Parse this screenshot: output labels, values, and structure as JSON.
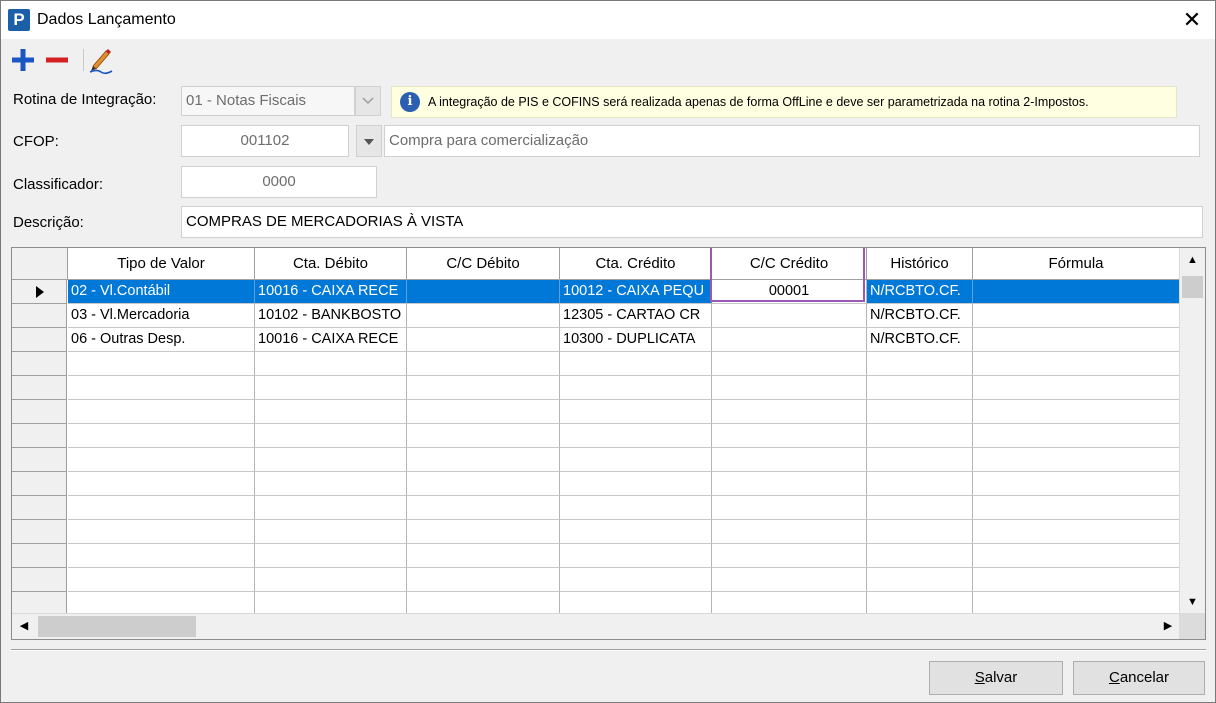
{
  "window": {
    "title": "Dados Lançamento",
    "app_icon_letter": "P",
    "close_glyph": "✕"
  },
  "toolbar": {
    "add_icon": "plus-icon",
    "remove_icon": "minus-icon",
    "edit_icon": "pencil-icon"
  },
  "form": {
    "rotina_label": "Rotina de Integração:",
    "rotina_value": "01 - Notas Fiscais",
    "info_text": "A integração de PIS e COFINS será realizada apenas de forma OffLine e deve ser parametrizada na rotina 2-Impostos.",
    "cfop_label": "CFOP:",
    "cfop_code": "001102",
    "cfop_desc": "Compra para comercialização",
    "classificador_label": "Classificador:",
    "classificador_value": "0000",
    "descricao_label": "Descrição:",
    "descricao_value": "COMPRAS DE MERCADORIAS À VISTA"
  },
  "grid": {
    "columns": [
      "Tipo de Valor",
      "Cta. Débito",
      "C/C Débito",
      "Cta. Crédito",
      "C/C Crédito",
      "Histórico",
      "Fórmula"
    ],
    "rows": [
      [
        "02 - Vl.Contábil",
        "10016 - CAIXA RECE",
        "",
        "10012 - CAIXA PEQU",
        "00001",
        "N/RCBTO.CF.",
        ""
      ],
      [
        "03 - Vl.Mercadoria",
        "10102 - BANKBOSTO",
        "",
        "12305 - CARTAO CR",
        "",
        "N/RCBTO.CF.",
        ""
      ],
      [
        "06 - Outras Desp.",
        "10016 - CAIXA RECE",
        "",
        "10300 - DUPLICATA",
        "",
        "N/RCBTO.CF.",
        ""
      ]
    ],
    "selected_row": 0
  },
  "buttons": {
    "salvar_accel": "S",
    "salvar_rest": "alvar",
    "cancelar_accel": "C",
    "cancelar_rest": "ancelar"
  },
  "colors": {
    "selection": "#0078d7",
    "focus_border": "#9b59b6",
    "info_bg": "#ffffe1",
    "add_icon": "#1a56c4",
    "remove_icon": "#d42020"
  }
}
